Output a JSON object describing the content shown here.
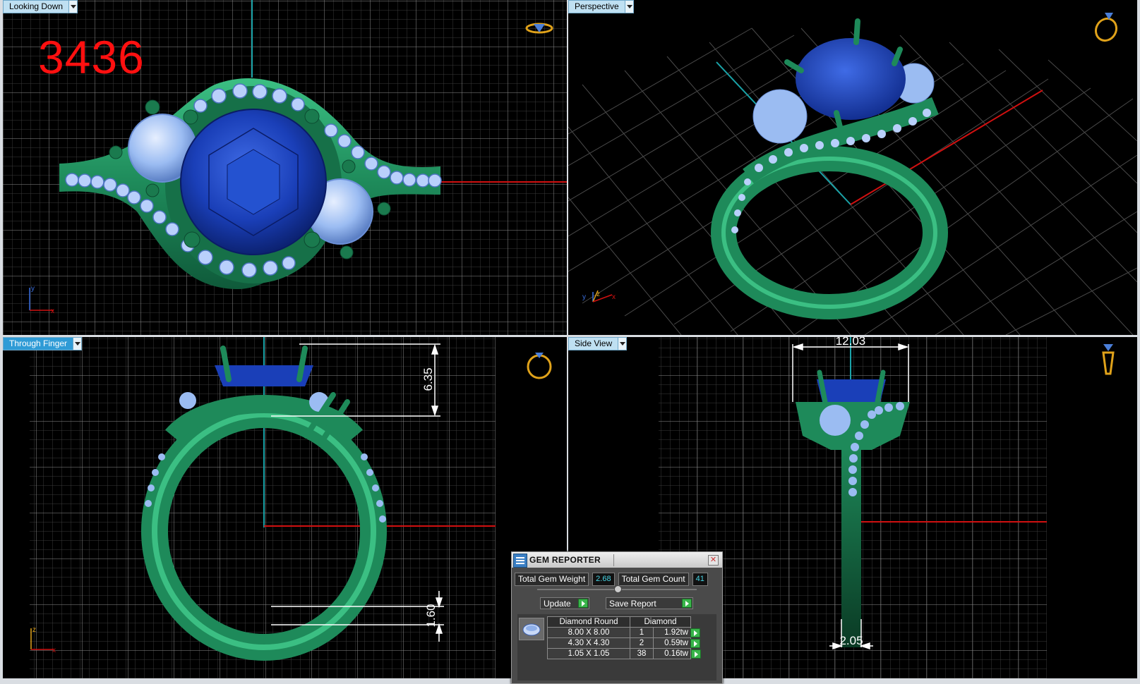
{
  "viewports": {
    "top_left": {
      "label": "Looking Down",
      "axes": [
        "y",
        "x"
      ]
    },
    "top_right": {
      "label": "Perspective",
      "axes": [
        "y",
        "z",
        "x"
      ]
    },
    "bottom_left": {
      "label": "Through Finger",
      "axes": [
        "z",
        "x"
      ]
    },
    "bottom_right": {
      "label": "Side View"
    }
  },
  "model_number": "3436",
  "dimensions": {
    "through_finger_height": "6.35",
    "through_finger_bottom": "1.60",
    "side_width_top": "12.03",
    "side_width_bottom": "2.05"
  },
  "gem_reporter": {
    "title": "GEM REPORTER",
    "total_gem_weight_label": "Total Gem Weight",
    "total_gem_weight": "2.68",
    "total_gem_count_label": "Total Gem Count",
    "total_gem_count": "41",
    "update_label": "Update",
    "save_report_label": "Save Report",
    "headers": [
      "Diamond Round",
      "Diamond"
    ],
    "rows": [
      {
        "size": "8.00 X 8.00",
        "count": "1",
        "weight": "1.92tw"
      },
      {
        "size": "4.30 X 4.30",
        "count": "2",
        "weight": "0.59tw"
      },
      {
        "size": "1.05 X 1.05",
        "count": "38",
        "weight": "0.16tw"
      }
    ]
  },
  "colors": {
    "metal": "#1e8a5a",
    "center_stone": "#1a3fb8",
    "diamond": "#9bbcf2",
    "grid": "#4a4a4a",
    "axis_red": "#d01010",
    "axis_teal": "#1aa3a8",
    "view_icon": "#e0a21a"
  }
}
